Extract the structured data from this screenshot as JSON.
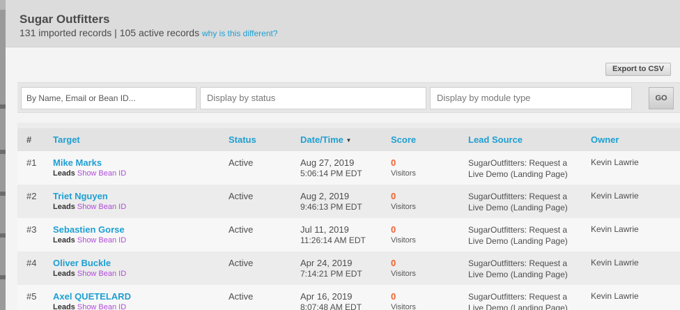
{
  "modal": {
    "title": "Sugar Outfitters",
    "subtitle": "131 imported records | 105 active records",
    "subtitle_link": "why is this different?"
  },
  "toolbar": {
    "export_label": "Export to CSV"
  },
  "filters": {
    "search_placeholder": "By Name, Email or Bean ID...",
    "status_placeholder": "Display by status",
    "module_placeholder": "Display by module type",
    "go_label": "GO"
  },
  "table": {
    "columns": [
      "#",
      "Target",
      "Status",
      "Date/Time",
      "Score",
      "Lead Source",
      "Owner"
    ],
    "sort_indicator": "▼",
    "rows": [
      {
        "num": "#1",
        "name": "Mike Marks",
        "module": "Leads",
        "bean_link": "Show Bean ID",
        "status": "Active",
        "date": "Aug 27, 2019",
        "time": "5:06:14 PM EDT",
        "score": "0",
        "score_label": "Visitors",
        "source_line1": "SugarOutfitters: Request a",
        "source_line2": "Live Demo (Landing Page)",
        "owner": "Kevin Lawrie"
      },
      {
        "num": "#2",
        "name": "Triet Nguyen",
        "module": "Leads",
        "bean_link": "Show Bean ID",
        "status": "Active",
        "date": "Aug 2, 2019",
        "time": "9:46:13 PM EDT",
        "score": "0",
        "score_label": "Visitors",
        "source_line1": "SugarOutfitters: Request a",
        "source_line2": "Live Demo (Landing Page)",
        "owner": "Kevin Lawrie"
      },
      {
        "num": "#3",
        "name": "Sebastien Gorse",
        "module": "Leads",
        "bean_link": "Show Bean ID",
        "status": "Active",
        "date": "Jul 11, 2019",
        "time": "11:26:14 AM EDT",
        "score": "0",
        "score_label": "Visitors",
        "source_line1": "SugarOutfitters: Request a",
        "source_line2": "Live Demo (Landing Page)",
        "owner": "Kevin Lawrie"
      },
      {
        "num": "#4",
        "name": "Oliver Buckle",
        "module": "Leads",
        "bean_link": "Show Bean ID",
        "status": "Active",
        "date": "Apr 24, 2019",
        "time": "7:14:21 PM EDT",
        "score": "0",
        "score_label": "Visitors",
        "source_line1": "SugarOutfitters: Request a",
        "source_line2": "Live Demo (Landing Page)",
        "owner": "Kevin Lawrie"
      },
      {
        "num": "#5",
        "name": "Axel QUETELARD",
        "module": "Leads",
        "bean_link": "Show Bean ID",
        "status": "Active",
        "date": "Apr 16, 2019",
        "time": "8:07:48 AM EDT",
        "score": "0",
        "score_label": "Visitors",
        "source_line1": "SugarOutfitters: Request a",
        "source_line2": "Live Demo (Landing Page)",
        "owner": "Kevin Lawrie"
      }
    ]
  },
  "colors": {
    "link": "#1e9fd2",
    "score": "#f0622f",
    "bean_link": "#b04bd9"
  }
}
